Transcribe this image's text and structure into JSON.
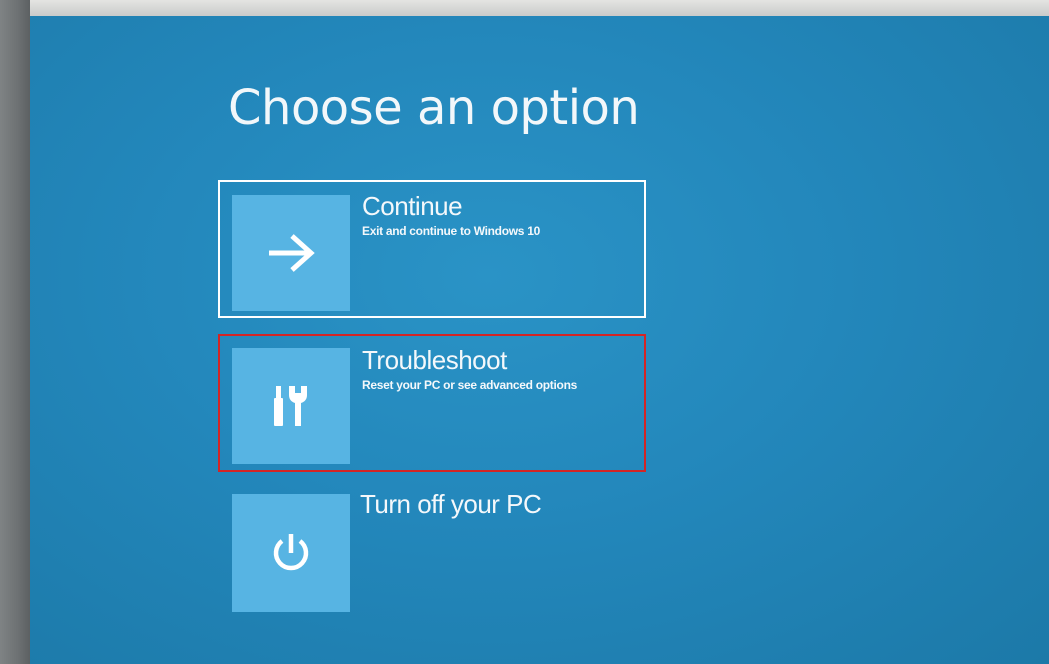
{
  "page": {
    "title": "Choose an option"
  },
  "options": [
    {
      "id": "continue",
      "label": "Continue",
      "description": "Exit and continue to Windows 10",
      "icon": "arrow-right-icon",
      "state": "focused"
    },
    {
      "id": "troubleshoot",
      "label": "Troubleshoot",
      "description": "Reset your PC or see advanced options",
      "icon": "tools-icon",
      "state": "highlighted"
    },
    {
      "id": "turn-off",
      "label": "Turn off your PC",
      "description": "",
      "icon": "power-icon",
      "state": "normal"
    }
  ],
  "colors": {
    "background": "#2387bb",
    "tile": "#57b4e3",
    "text": "#f4f8fb",
    "focus_border": "#ffffff",
    "highlight_border": "#d42525"
  }
}
